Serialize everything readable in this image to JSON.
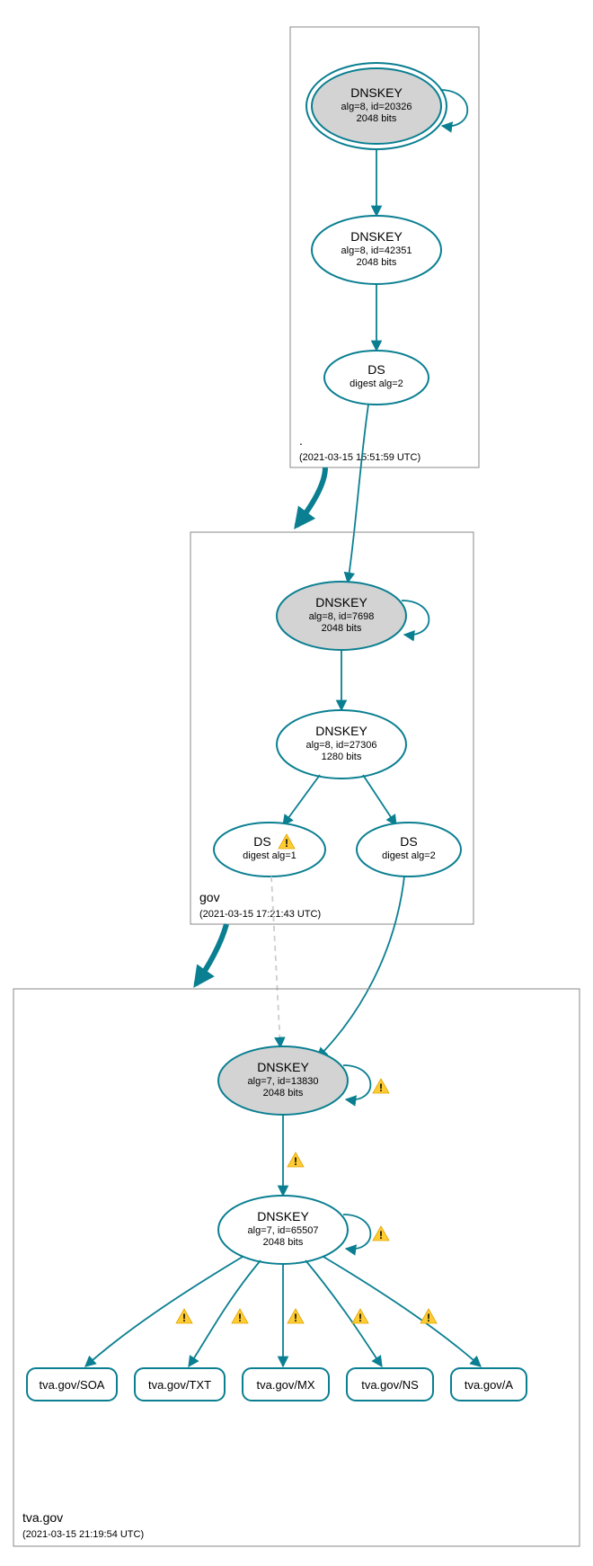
{
  "zones": {
    "root": {
      "name": ".",
      "timestamp": "(2021-03-15 15:51:59 UTC)",
      "dnskey1": {
        "title": "DNSKEY",
        "line1": "alg=8, id=20326",
        "line2": "2048 bits"
      },
      "dnskey2": {
        "title": "DNSKEY",
        "line1": "alg=8, id=42351",
        "line2": "2048 bits"
      },
      "ds": {
        "title": "DS",
        "line1": "digest alg=2"
      }
    },
    "gov": {
      "name": "gov",
      "timestamp": "(2021-03-15 17:21:43 UTC)",
      "dnskey1": {
        "title": "DNSKEY",
        "line1": "alg=8, id=7698",
        "line2": "2048 bits"
      },
      "dnskey2": {
        "title": "DNSKEY",
        "line1": "alg=8, id=27306",
        "line2": "1280 bits"
      },
      "ds1": {
        "title": "DS",
        "line1": "digest alg=1"
      },
      "ds2": {
        "title": "DS",
        "line1": "digest alg=2"
      }
    },
    "tva": {
      "name": "tva.gov",
      "timestamp": "(2021-03-15 21:19:54 UTC)",
      "dnskey1": {
        "title": "DNSKEY",
        "line1": "alg=7, id=13830",
        "line2": "2048 bits"
      },
      "dnskey2": {
        "title": "DNSKEY",
        "line1": "alg=7, id=65507",
        "line2": "2048 bits"
      },
      "records": {
        "soa": "tva.gov/SOA",
        "txt": "tva.gov/TXT",
        "mx": "tva.gov/MX",
        "ns": "tva.gov/NS",
        "a": "tva.gov/A"
      }
    }
  },
  "colors": {
    "stroke": "#0a7f91",
    "grey": "#d3d3d3",
    "warn": "#ffcc33"
  }
}
